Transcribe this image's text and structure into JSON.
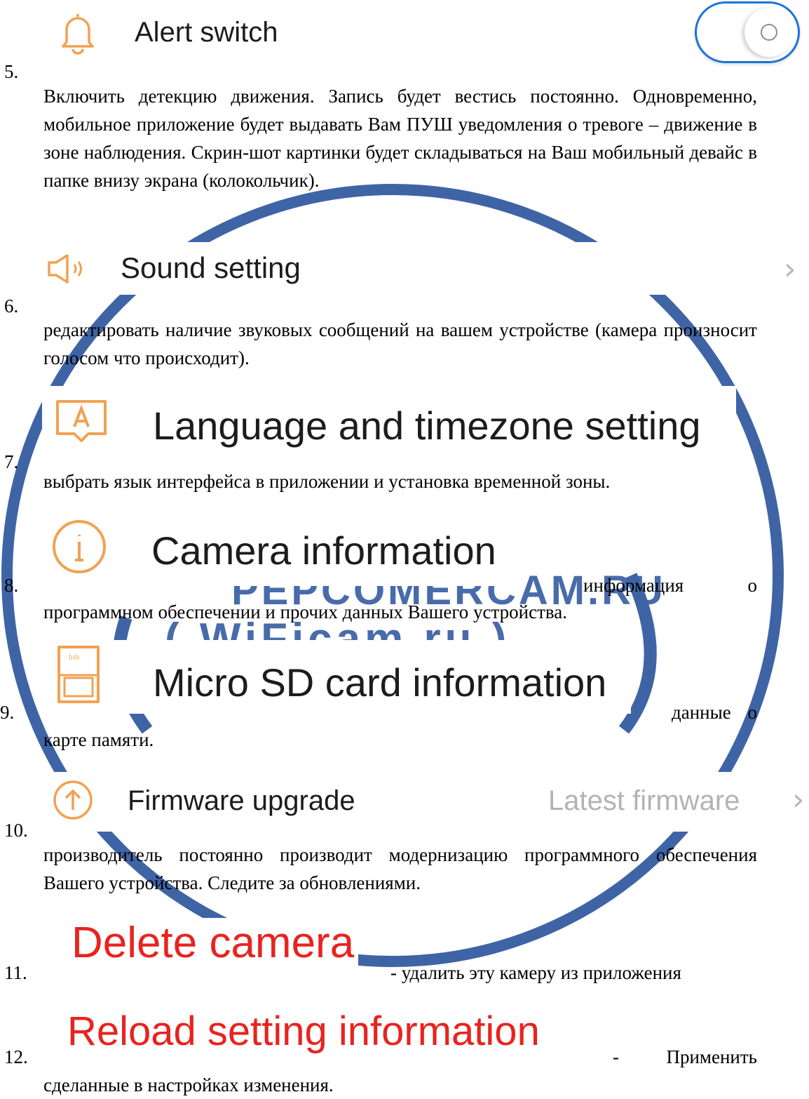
{
  "items": [
    {
      "number": "5.",
      "ui_label": "Alert switch",
      "icon": "bell-icon",
      "toggle_state": "off",
      "text": "Включить детекцию движения. Запись будет вестись постоянно. Одновременно, мобильное приложение будет выдавать Вам ПУШ уведомления о тревоге – движение в зоне наблюдения. Скрин-шот картинки будет складываться на Ваш мобильный девайс в папке внизу экрана (колокольчик)."
    },
    {
      "number": "6.",
      "ui_label": "Sound setting",
      "icon": "speaker-icon",
      "text": "редактировать наличие звуковых сообщений на вашем устройстве (камера произносит голосом что  происходит)."
    },
    {
      "number": "7.",
      "ui_label": "Language and timezone setting",
      "icon": "language-icon",
      "text": "выбрать язык интерфейса в приложении и установка временной зоны."
    },
    {
      "number": "8.",
      "ui_label": "Camera information",
      "icon": "info-icon",
      "text_inline": "информация о",
      "text": "программном обеспечении и прочих данных Вашего устройства."
    },
    {
      "number": "9.",
      "ui_label": "Micro SD card information",
      "icon": "sd-card-icon",
      "text_inline": "данные о",
      "text": "карте памяти."
    },
    {
      "number": "10.",
      "ui_label": "Firmware upgrade",
      "icon": "upgrade-arrow-icon",
      "value": "Latest firmware",
      "text": "производитель постоянно производит модернизацию программного обеспечения Вашего устройства. Следите за обновлениями."
    },
    {
      "number": "11.",
      "ui_label": "Delete camera",
      "text": "- удалить эту камеру из приложения"
    },
    {
      "number": "12.",
      "ui_label": "Reload setting information",
      "text_inline": "- Применить",
      "text": "сделанные в настройках изменения."
    }
  ],
  "watermark": {
    "line1": "PEPCOMERCAM.RU",
    "line2": "( WiFicam.ru )"
  },
  "colors": {
    "icon": "#f0a253",
    "danger": "#e8231f",
    "watermark": "#3f64a6"
  }
}
